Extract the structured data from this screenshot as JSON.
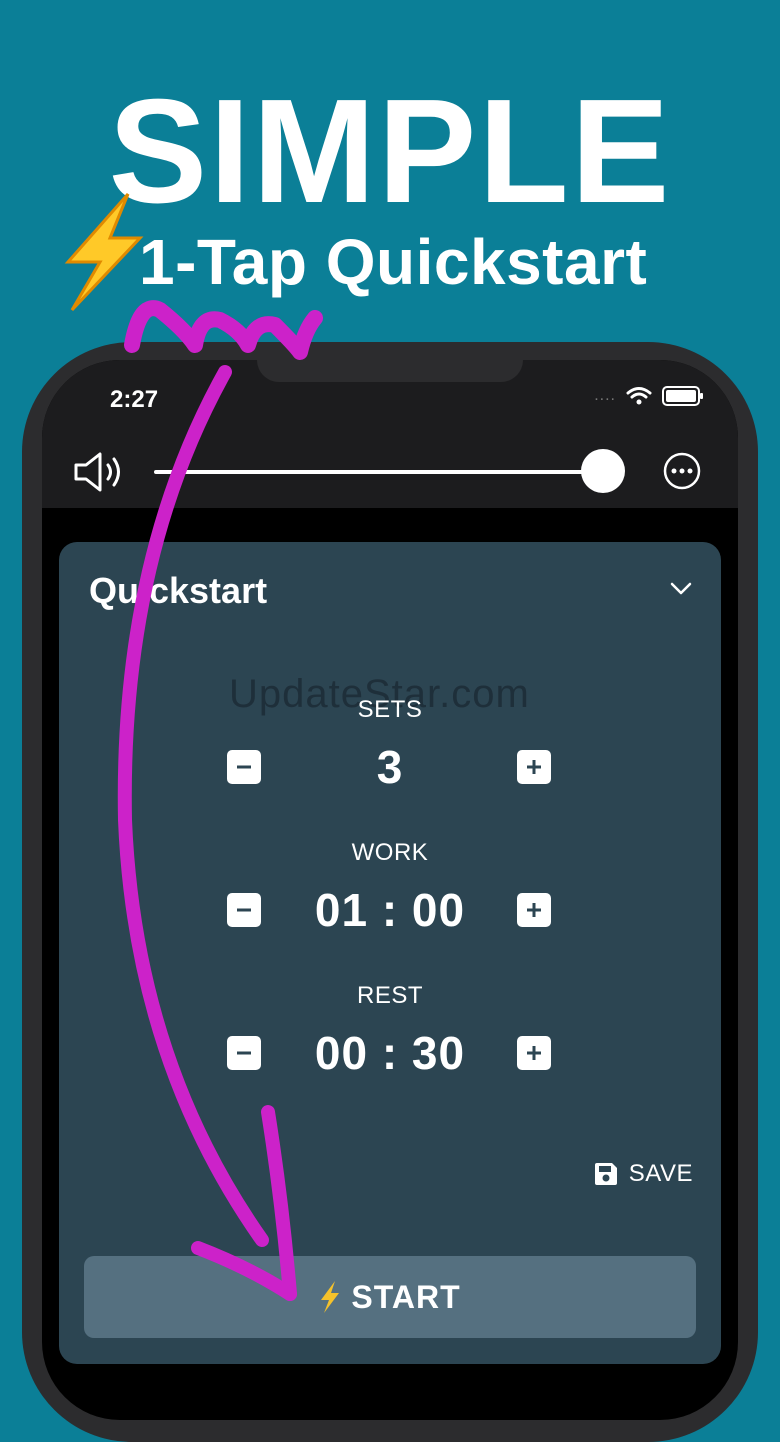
{
  "promo": {
    "headline": "SIMPLE",
    "subheadline": "1-Tap Quickstart"
  },
  "status_bar": {
    "time": "2:27",
    "signal": "....",
    "icons": [
      "wifi-icon",
      "battery-icon"
    ]
  },
  "toolbar": {
    "volume_icon": "speaker-icon",
    "volume_level": 1.0,
    "more_icon": "more-icon"
  },
  "quickstart": {
    "title": "Quickstart",
    "watermark": "UpdateStar.com",
    "sets": {
      "label": "SETS",
      "value": "3"
    },
    "work": {
      "label": "WORK",
      "value": "01 : 00"
    },
    "rest": {
      "label": "REST",
      "value": "00 : 30"
    },
    "save_label": "SAVE",
    "start_label": "START"
  },
  "colors": {
    "background": "#0b7f97",
    "card": "#2c4552",
    "start_button": "#557080",
    "annotation": "#cc22c9",
    "bolt": "#f5c22b"
  }
}
